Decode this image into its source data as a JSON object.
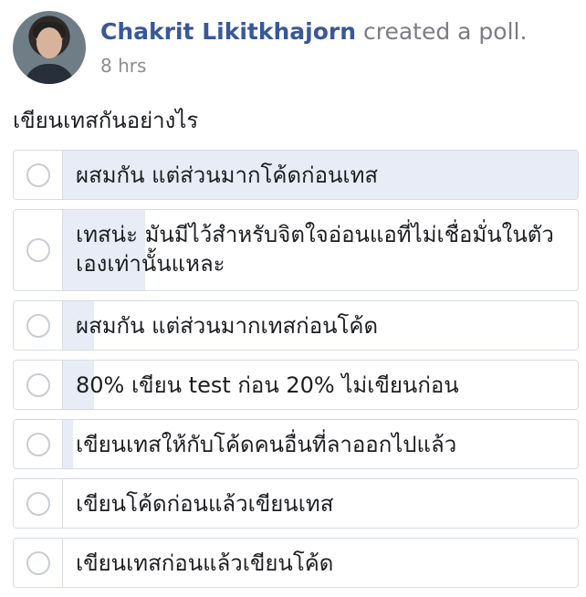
{
  "post": {
    "author": "Chakrit Likitkhajorn",
    "action": "created a poll.",
    "timestamp": "8 hrs"
  },
  "poll": {
    "question": "เขียนเทสกันอย่างไร",
    "options": [
      {
        "label": "ผสมกัน แต่ส่วนมากโค้ดก่อนเทส",
        "vote_fraction": 1.0
      },
      {
        "label": "เทสน่ะ มันมีไว้สำหรับจิตใจอ่อนแอที่ไม่เชื่อมั่นในตัวเองเท่านั้นแหละ",
        "vote_fraction": 0.16
      },
      {
        "label": "ผสมกัน แต่ส่วนมากเทสก่อนโค้ด",
        "vote_fraction": 0.06
      },
      {
        "label": "80% เขียน test ก่อน 20% ไม่เขียนก่อน",
        "vote_fraction": 0.06
      },
      {
        "label": "เขียนเทสให้กับโค้ดคนอื่นที่ลาออกไปแล้ว",
        "vote_fraction": 0.02
      },
      {
        "label": "เขียนโค้ดก่อนแล้วเขียนเทส",
        "vote_fraction": 0.0
      },
      {
        "label": "เขียนเทสก่อนแล้วเขียนโค้ด",
        "vote_fraction": 0.0
      }
    ]
  },
  "colors": {
    "author": "#385898",
    "vote_fill": "#e7ecf7",
    "border": "#d8dce3"
  }
}
